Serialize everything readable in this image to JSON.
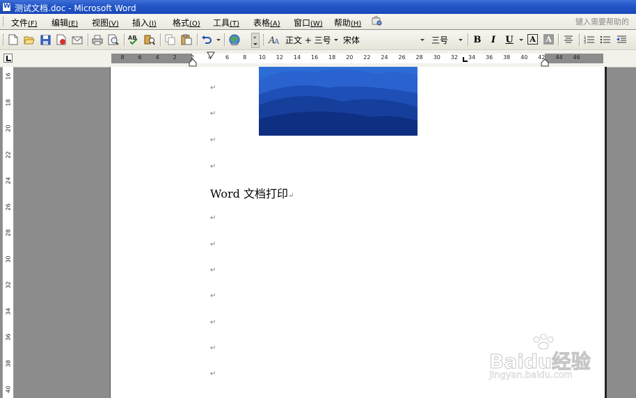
{
  "window": {
    "title": "测试文档.doc - Microsoft Word"
  },
  "menu": {
    "items": [
      {
        "label": "文件",
        "key": "(F)"
      },
      {
        "label": "编辑",
        "key": "(E)"
      },
      {
        "label": "视图",
        "key": "(V)"
      },
      {
        "label": "插入",
        "key": "(I)"
      },
      {
        "label": "格式",
        "key": "(O)"
      },
      {
        "label": "工具",
        "key": "(T)"
      },
      {
        "label": "表格",
        "key": "(A)"
      },
      {
        "label": "窗口",
        "key": "(W)"
      },
      {
        "label": "帮助",
        "key": "(H)"
      }
    ],
    "help_placeholder": "键入需要帮助的"
  },
  "toolbar": {
    "style_value": "正文 + 三号",
    "font_value": "宋体",
    "size_value": "三号",
    "bold_label": "B",
    "italic_label": "I",
    "underline_label": "U",
    "font_color_label": "A",
    "highlight_label": "A"
  },
  "ruler": {
    "horizontal_numbers": [
      "8",
      "6",
      "4",
      "2",
      "2",
      "4",
      "6",
      "8",
      "10",
      "12",
      "14",
      "16",
      "18",
      "20",
      "22",
      "24",
      "26",
      "28",
      "30",
      "32",
      "34",
      "36",
      "38",
      "40",
      "42",
      "44",
      "46"
    ],
    "vertical_numbers": [
      "16",
      "18",
      "20",
      "22",
      "24",
      "26",
      "28",
      "30",
      "32",
      "34",
      "36",
      "38",
      "40"
    ]
  },
  "document": {
    "text_line": "Word 文档打印",
    "paragraph_mark": "↵"
  },
  "watermark": {
    "main": "Baidu经验",
    "sub": "jingyan.baidu.com"
  }
}
